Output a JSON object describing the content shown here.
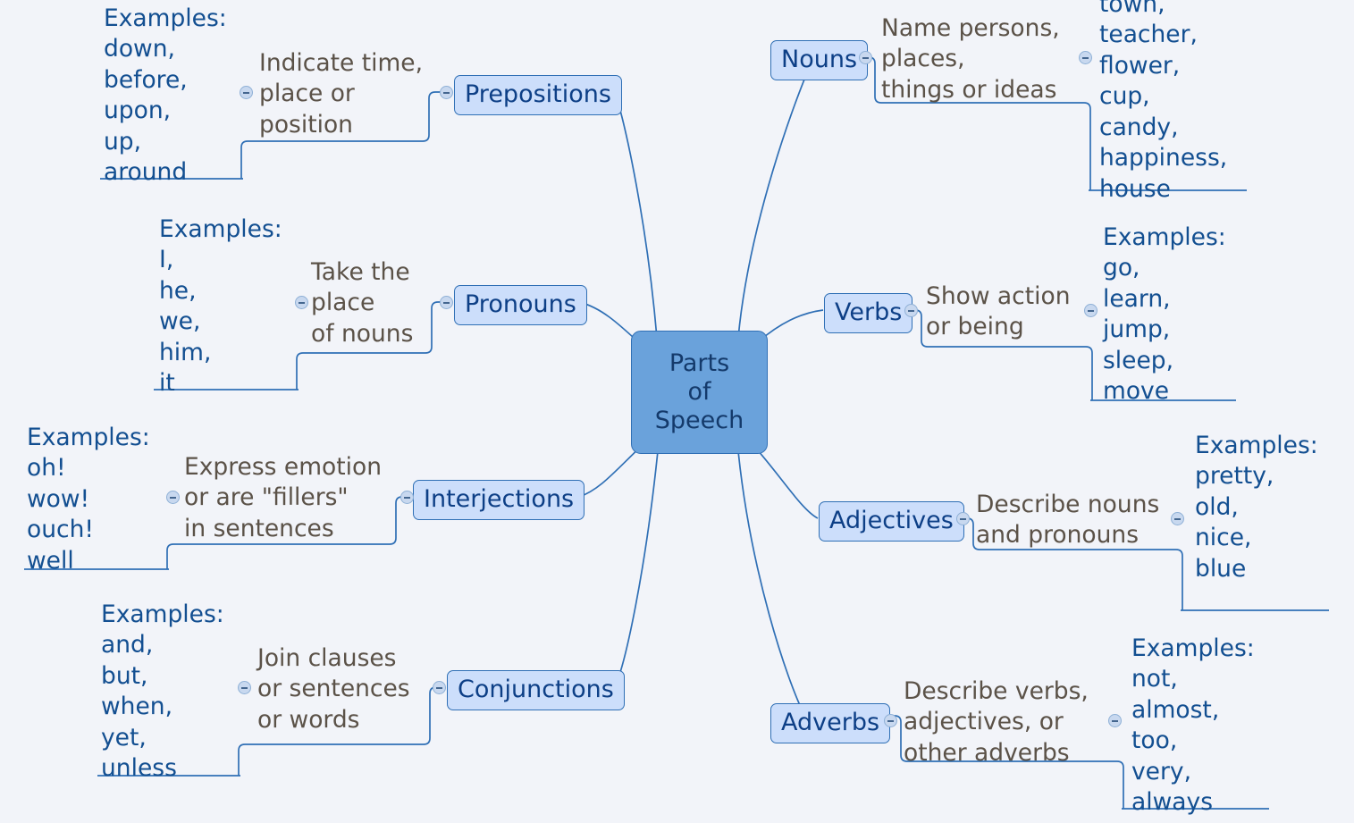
{
  "diagram": {
    "title": "Parts of Speech",
    "type": "mind-map",
    "background_color": "#f2f4f9",
    "center": {
      "label_lines": [
        "Parts",
        "of",
        "Speech"
      ],
      "fill": "#6aa2db",
      "border": "#2f6fb5",
      "text_color": "#143a6b"
    },
    "node_style": {
      "fill": "#ccdefb",
      "border": "#2f6fb5",
      "text_color": "#0d3f86"
    },
    "desc_text_color": "#5b5248",
    "example_text_color": "#134f91",
    "connector_color": "#2f6fb5",
    "toggle_icon": "collapse-minus-icon"
  },
  "branches": [
    {
      "id": "prepositions",
      "label": "Prepositions",
      "side": "left",
      "description": "Indicate time,\nplace or\nposition",
      "examples": "Examples:\ndown,\nbefore,\nupon,\nup,\naround"
    },
    {
      "id": "pronouns",
      "label": "Pronouns",
      "side": "left",
      "description": "Take the\nplace\nof nouns",
      "examples": "Examples:\nI,\nhe,\nwe,\nhim,\nit"
    },
    {
      "id": "interjections",
      "label": "Interjections",
      "side": "left",
      "description": "Express emotion\nor are \"fillers\"\nin sentences",
      "examples": "Examples:\noh!\nwow!\nouch!\nwell"
    },
    {
      "id": "conjunctions",
      "label": "Conjunctions",
      "side": "left",
      "description": "Join clauses\nor sentences\nor words",
      "examples": "Examples:\nand,\nbut,\nwhen,\nyet,\nunless"
    },
    {
      "id": "nouns",
      "label": "Nouns",
      "side": "right",
      "description": "Name persons,\nplaces,\nthings or ideas",
      "examples": "town,\nteacher,\nflower,\ncup,\ncandy,\nhappiness,\nhouse"
    },
    {
      "id": "verbs",
      "label": "Verbs",
      "side": "right",
      "description": "Show action\nor being",
      "examples": "Examples:\ngo,\nlearn,\njump,\nsleep,\nmove"
    },
    {
      "id": "adjectives",
      "label": "Adjectives",
      "side": "right",
      "description": "Describe nouns\nand pronouns",
      "examples": "Examples:\npretty,\nold,\nnice,\nblue"
    },
    {
      "id": "adverbs",
      "label": "Adverbs",
      "side": "right",
      "description": "Describe verbs,\nadjectives, or\nother adverbs",
      "examples": "Examples:\nnot,\nalmost,\ntoo,\nvery,\nalways"
    }
  ]
}
